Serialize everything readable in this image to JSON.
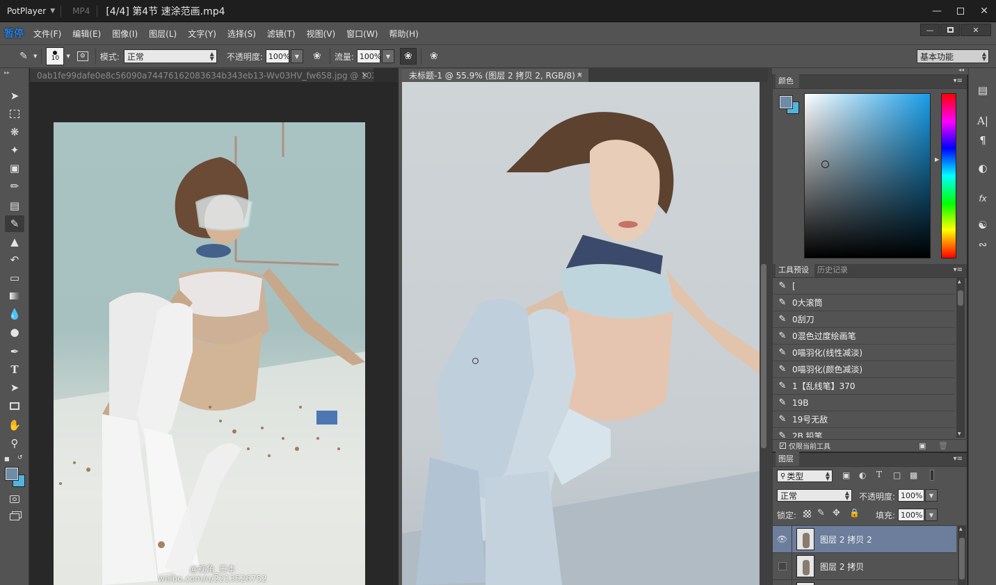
{
  "player": {
    "logo_text": "PotPlayer",
    "format": "MP4",
    "title": "[4/4] 第4节  速涂范画.mp4"
  },
  "app": {
    "logo": "暂停",
    "menus": [
      "文件(F)",
      "编辑(E)",
      "图像(I)",
      "图层(L)",
      "文字(Y)",
      "选择(S)",
      "滤镜(T)",
      "视图(V)",
      "窗口(W)",
      "帮助(H)"
    ],
    "workspace": "基本功能"
  },
  "options": {
    "brush_size": "10",
    "mode_label": "模式:",
    "mode_value": "正常",
    "opacity_label": "不透明度:",
    "opacity_value": "100%",
    "flow_label": "流量:",
    "flow_value": "100%"
  },
  "documents": [
    {
      "title": "0ab1fe99dafe0e8c56090a74476162083634b343eb13-Wv03HV_fw658.jpg @ 102...",
      "active": false
    },
    {
      "title": "未标题-1 @ 55.9% (图层 2 拷贝 2, RGB/8) *",
      "active": true
    }
  ],
  "reference_photo": {
    "watermark_line1": "@视角_日本",
    "watermark_line2": "weibo.com/u/2213526752"
  },
  "color_panel": {
    "tab": "颜色",
    "foreground": "#6d8ca8",
    "background": "#4fb6e0"
  },
  "presets_panel": {
    "tabs": [
      "工具预设",
      "历史记录"
    ],
    "items": [
      "[",
      "0大滚筒",
      "0刮刀",
      "0混色过度绘画笔",
      "0喵羽化(线性减淡)",
      "0喵羽化(颜色减淡)",
      "1【乱线笔】370",
      "19B",
      "19号无敌",
      "2B 铅笔"
    ],
    "current_only_label": "仅限当前工具"
  },
  "layers_panel": {
    "tab": "图层",
    "filter_kind": "类型",
    "blend_mode": "正常",
    "opacity_label": "不透明度:",
    "opacity_value": "100%",
    "lock_label": "锁定:",
    "fill_label": "填充:",
    "fill_value": "100%",
    "layers": [
      {
        "name": "图层 2 拷贝 2",
        "visible": true,
        "selected": true
      },
      {
        "name": "图层 2 拷贝",
        "visible": false,
        "selected": false
      }
    ]
  }
}
